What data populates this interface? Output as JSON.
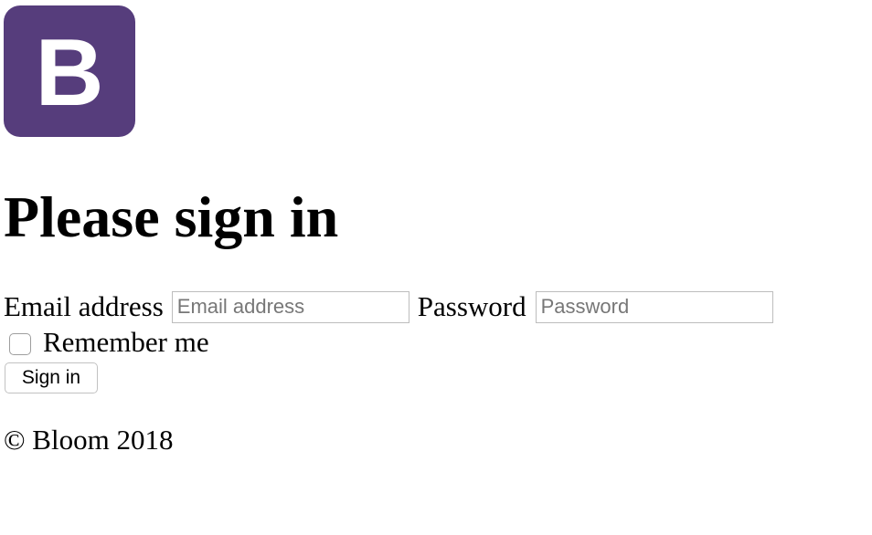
{
  "logo": {
    "letter": "B",
    "color": "#563d7c"
  },
  "heading": "Please sign in",
  "form": {
    "email_label": "Email address",
    "email_placeholder": "Email address",
    "email_value": "",
    "password_label": "Password",
    "password_placeholder": "Password",
    "password_value": "",
    "remember_label": "Remember me",
    "remember_checked": false,
    "submit_label": "Sign in"
  },
  "footer": "© Bloom 2018"
}
